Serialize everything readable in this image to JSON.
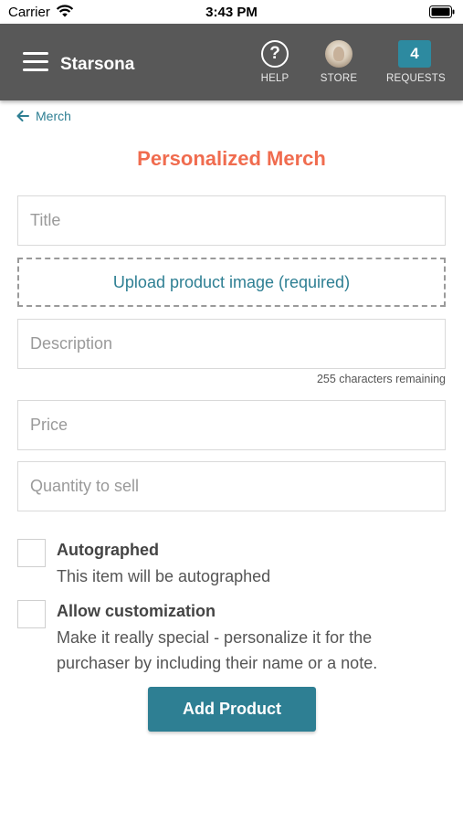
{
  "status_bar": {
    "carrier": "Carrier",
    "time": "3:43 PM"
  },
  "header": {
    "brand": "Starsona",
    "nav": {
      "help": {
        "icon": "question-circle-icon",
        "label": "HELP"
      },
      "store": {
        "icon": "avatar",
        "label": "STORE"
      },
      "requests": {
        "count": "4",
        "label": "REQUESTS"
      }
    }
  },
  "back_link": {
    "label": "Merch",
    "icon": "arrow-left-icon"
  },
  "page_title": "Personalized Merch",
  "form": {
    "title_placeholder": "Title",
    "upload_label": "Upload product image (required)",
    "description_placeholder": "Description",
    "char_remaining": "255 characters remaining",
    "price_placeholder": "Price",
    "quantity_placeholder": "Quantity to sell"
  },
  "options": {
    "autographed": {
      "title": "Autographed",
      "description": "This item will be autographed",
      "checked": false
    },
    "customization": {
      "title": "Allow customization",
      "description": "Make it really special - personalize it for the purchaser by including their name or a note.",
      "checked": false
    }
  },
  "submit_label": "Add Product",
  "colors": {
    "header_bg": "#585858",
    "accent": "#2e7f93",
    "title": "#f06c4f",
    "badge": "#2d8aa0"
  }
}
